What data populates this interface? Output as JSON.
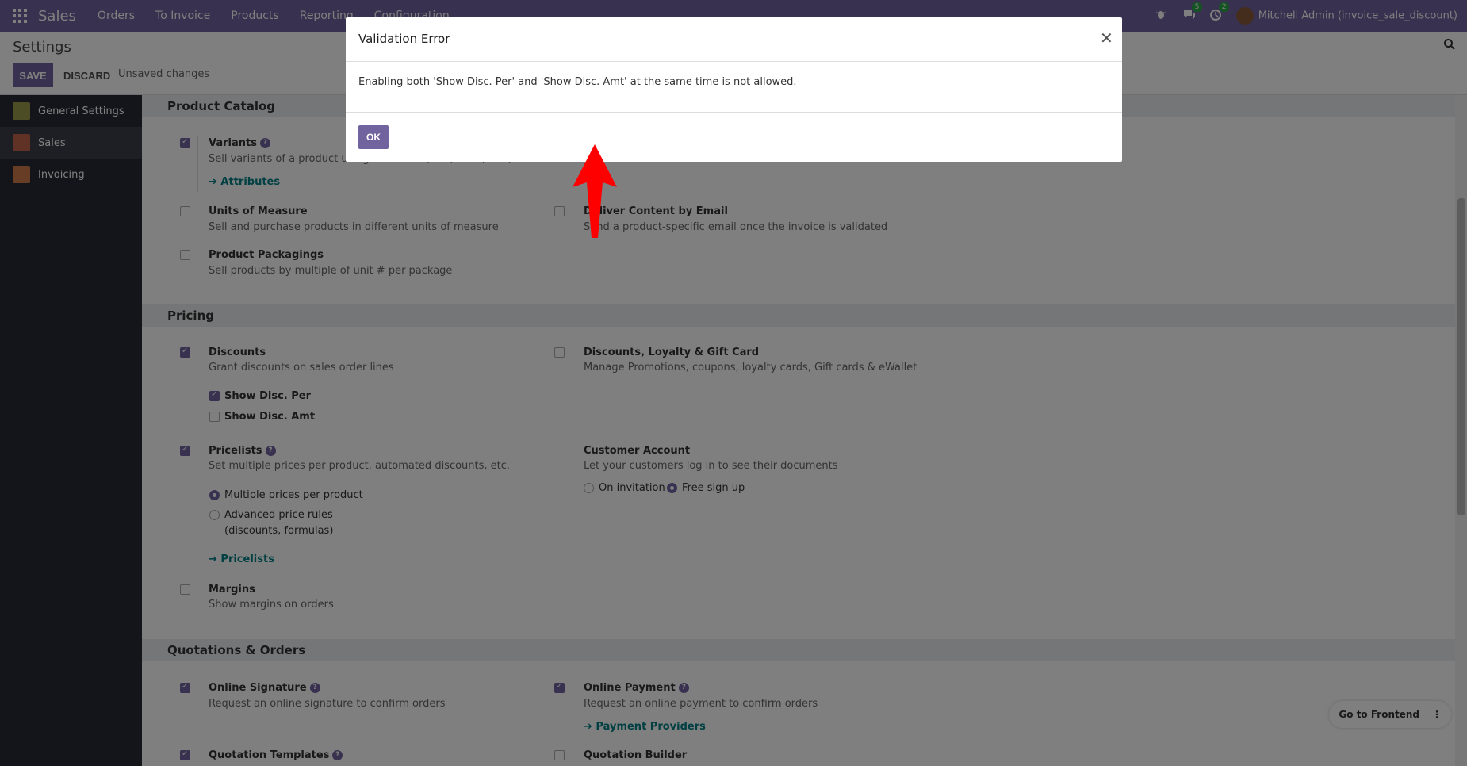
{
  "topbar": {
    "brand": "Sales",
    "menu": [
      "Orders",
      "To Invoice",
      "Products",
      "Reporting",
      "Configuration"
    ],
    "messages_count": "5",
    "activities_count": "2",
    "user": "Mitchell Admin (invoice_sale_discount)"
  },
  "control_panel": {
    "breadcrumb": "Settings",
    "save_label": "SAVE",
    "discard_label": "DISCARD",
    "status": "Unsaved changes"
  },
  "sidebar": {
    "items": [
      {
        "label": "General Settings"
      },
      {
        "label": "Sales"
      },
      {
        "label": "Invoicing"
      }
    ]
  },
  "sections": {
    "product_catalog": {
      "title": "Product Catalog",
      "variants": {
        "label": "Variants",
        "desc": "Sell variants of a product using attributes (size, color, etc.)",
        "link": "Attributes",
        "checked": true
      },
      "uom": {
        "label": "Units of Measure",
        "desc": "Sell and purchase products in different units of measure",
        "checked": false
      },
      "packagings": {
        "label": "Product Packagings",
        "desc": "Sell products by multiple of unit # per package",
        "checked": false
      },
      "deliver_content": {
        "label": "Deliver Content by Email",
        "desc": "Send a product-specific email once the invoice is validated",
        "checked": false
      }
    },
    "pricing": {
      "title": "Pricing",
      "discounts": {
        "label": "Discounts",
        "desc": "Grant discounts on sales order lines",
        "checked": true
      },
      "show_disc_per": {
        "label": "Show Disc. Per",
        "checked": true
      },
      "show_disc_amt": {
        "label": "Show Disc. Amt",
        "checked": false
      },
      "loyalty": {
        "label": "Discounts, Loyalty & Gift Card",
        "desc": "Manage Promotions, coupons, loyalty cards, Gift cards & eWallet",
        "checked": false
      },
      "pricelists": {
        "label": "Pricelists",
        "desc": "Set multiple prices per product, automated discounts, etc.",
        "checked": true,
        "link": "Pricelists"
      },
      "pricelist_multiple": "Multiple prices per product",
      "pricelist_advanced_1": "Advanced price rules",
      "pricelist_advanced_2": "(discounts, formulas)",
      "customer_account": {
        "label": "Customer Account",
        "desc": "Let your customers log in to see their documents",
        "opt_invitation": "On invitation",
        "opt_free": "Free sign up"
      },
      "margins": {
        "label": "Margins",
        "desc": "Show margins on orders",
        "checked": false
      }
    },
    "quotations": {
      "title": "Quotations & Orders",
      "online_signature": {
        "label": "Online Signature",
        "desc": "Request an online signature to confirm orders",
        "checked": true
      },
      "online_payment": {
        "label": "Online Payment",
        "desc": "Request an online payment to confirm orders",
        "checked": true,
        "link": "Payment Providers"
      },
      "quotation_templates": {
        "label": "Quotation Templates",
        "checked": true
      },
      "quotation_builder": {
        "label": "Quotation Builder",
        "checked": false
      }
    }
  },
  "dialog": {
    "title": "Validation Error",
    "message": "Enabling both 'Show Disc. Per' and 'Show Disc. Amt' at the same time is not allowed.",
    "ok_label": "OK"
  },
  "frontend_button": "Go to Frontend",
  "colors": {
    "accent": "#71639e",
    "link": "#017e84",
    "arrow": "#ff0000"
  }
}
